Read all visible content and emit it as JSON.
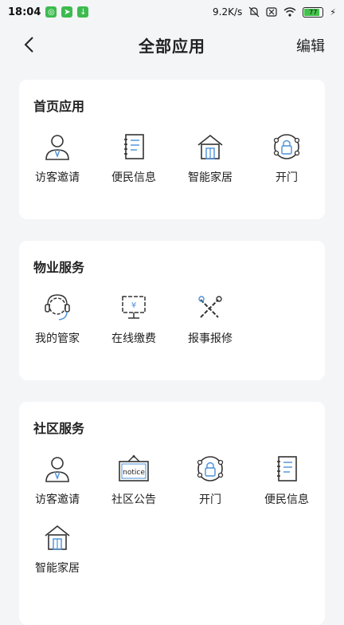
{
  "status": {
    "time": "18:04",
    "speed": "9.2K/s",
    "battery": "77"
  },
  "header": {
    "title": "全部应用",
    "edit_label": "编辑"
  },
  "sections": [
    {
      "title": "首页应用",
      "apps": [
        {
          "label": "访客邀请",
          "icon": "visitor-icon"
        },
        {
          "label": "便民信息",
          "icon": "notebook-icon"
        },
        {
          "label": "智能家居",
          "icon": "house-icon"
        },
        {
          "label": "开门",
          "icon": "lock-icon"
        }
      ]
    },
    {
      "title": "物业服务",
      "apps": [
        {
          "label": "我的管家",
          "icon": "headset-icon"
        },
        {
          "label": "在线缴费",
          "icon": "payment-icon"
        },
        {
          "label": "报事报修",
          "icon": "tools-icon"
        }
      ]
    },
    {
      "title": "社区服务",
      "apps": [
        {
          "label": "访客邀请",
          "icon": "visitor-icon"
        },
        {
          "label": "社区公告",
          "icon": "notice-icon",
          "icon_text": "notice"
        },
        {
          "label": "开门",
          "icon": "lock-icon"
        },
        {
          "label": "便民信息",
          "icon": "notebook-icon"
        },
        {
          "label": "智能家居",
          "icon": "house-icon"
        }
      ]
    }
  ]
}
